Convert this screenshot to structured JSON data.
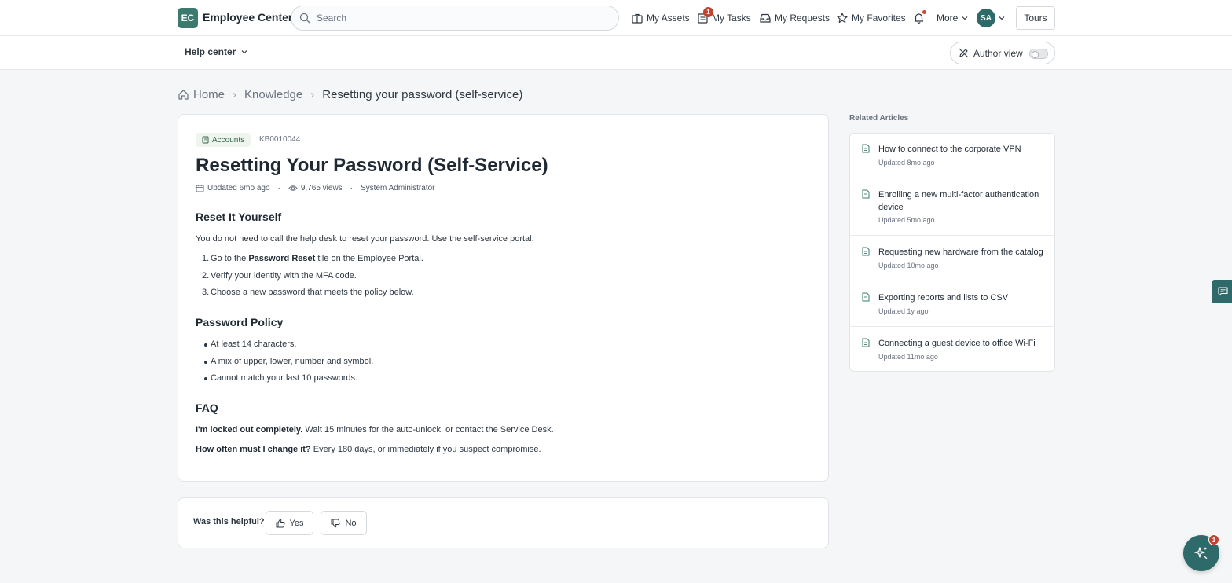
{
  "header": {
    "logo_initials": "EC",
    "app_title": "Employee Center",
    "search_placeholder": "Search",
    "nav": {
      "assets": "My Assets",
      "tasks": "My Tasks",
      "tasks_badge": "1",
      "requests": "My Requests",
      "favorites": "My Favorites",
      "more": "More"
    },
    "avatar_initials": "SA",
    "tours": "Tours"
  },
  "subheader": {
    "help_center": "Help center",
    "author_view": "Author view",
    "author_view_enabled": false
  },
  "breadcrumb": {
    "home": "Home",
    "knowledge": "Knowledge",
    "current": "Resetting your password (self-service)"
  },
  "article": {
    "category": "Accounts",
    "number": "KB0010044",
    "title": "Resetting Your Password (Self-Service)",
    "updated": "Updated 6mo ago",
    "views": "9,765 views",
    "author": "System Administrator",
    "section1": {
      "heading": "Reset It Yourself",
      "intro": "You do not need to call the help desk to reset your password. Use the self-service portal.",
      "steps": [
        {
          "num": "1.",
          "before": "Go to the ",
          "bold": "Password Reset",
          "after": " tile on the Employee Portal."
        },
        {
          "num": "2.",
          "text": "Verify your identity with the MFA code."
        },
        {
          "num": "3.",
          "text": "Choose a new password that meets the policy below."
        }
      ]
    },
    "section2": {
      "heading": "Password Policy",
      "items": [
        "At least 14 characters.",
        "A mix of upper, lower, number and symbol.",
        "Cannot match your last 10 passwords."
      ]
    },
    "section3": {
      "heading": "FAQ",
      "faqs": [
        {
          "q": "I'm locked out completely.",
          "a": " Wait 15 minutes for the auto-unlock, or contact the Service Desk."
        },
        {
          "q": "How often must I change it?",
          "a": " Every 180 days, or immediately if you suspect compromise."
        }
      ]
    }
  },
  "feedback": {
    "question": "Was this helpful?",
    "yes": "Yes",
    "no": "No"
  },
  "related": {
    "heading": "Related Articles",
    "items": [
      {
        "title": "How to connect to the corporate VPN",
        "updated": "Updated 8mo ago"
      },
      {
        "title": "Enrolling a new multi-factor authentication device",
        "updated": "Updated 5mo ago"
      },
      {
        "title": "Requesting new hardware from the catalog",
        "updated": "Updated 10mo ago"
      },
      {
        "title": "Exporting reports and lists to CSV",
        "updated": "Updated 1y ago"
      },
      {
        "title": "Connecting a guest device to office Wi-Fi",
        "updated": "Updated 11mo ago"
      }
    ]
  },
  "chat": {
    "badge": "1"
  },
  "colors": {
    "brand": "#3d7a6e",
    "brand_dark": "#2f6a6a",
    "badge_red": "#c2422e",
    "tag_bg": "#eef5ef"
  }
}
